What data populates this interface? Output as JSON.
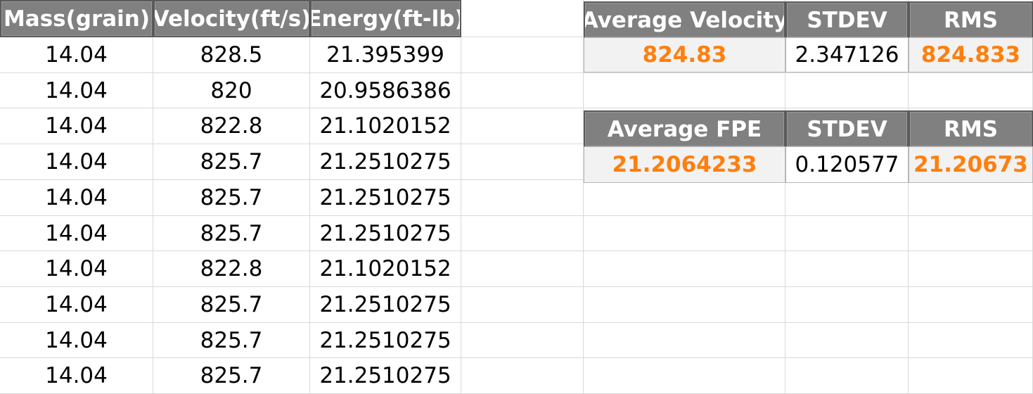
{
  "theme": {
    "header_bg": "#808080",
    "header_text": "#ffffff",
    "accent_text": "#ff7f0e",
    "stat_cell_bg": "#f2f2f2",
    "gridline": "#d9d9d9"
  },
  "data_table": {
    "headers": [
      "Mass(grain)",
      "Velocity(ft/s)",
      "Energy(ft-lb)"
    ],
    "rows": [
      [
        "14.04",
        "828.5",
        "21.395399"
      ],
      [
        "14.04",
        "820",
        "20.9586386"
      ],
      [
        "14.04",
        "822.8",
        "21.1020152"
      ],
      [
        "14.04",
        "825.7",
        "21.2510275"
      ],
      [
        "14.04",
        "825.7",
        "21.2510275"
      ],
      [
        "14.04",
        "825.7",
        "21.2510275"
      ],
      [
        "14.04",
        "822.8",
        "21.1020152"
      ],
      [
        "14.04",
        "825.7",
        "21.2510275"
      ],
      [
        "14.04",
        "825.7",
        "21.2510275"
      ],
      [
        "14.04",
        "825.7",
        "21.2510275"
      ]
    ]
  },
  "velocity_stats": {
    "headers": [
      "Average Velocity",
      "STDEV",
      "RMS"
    ],
    "values": [
      "824.83",
      "2.347126",
      "824.833"
    ]
  },
  "energy_stats": {
    "headers": [
      "Average FPE",
      "STDEV",
      "RMS"
    ],
    "values": [
      "21.2064233",
      "0.120577",
      "21.20673"
    ]
  }
}
